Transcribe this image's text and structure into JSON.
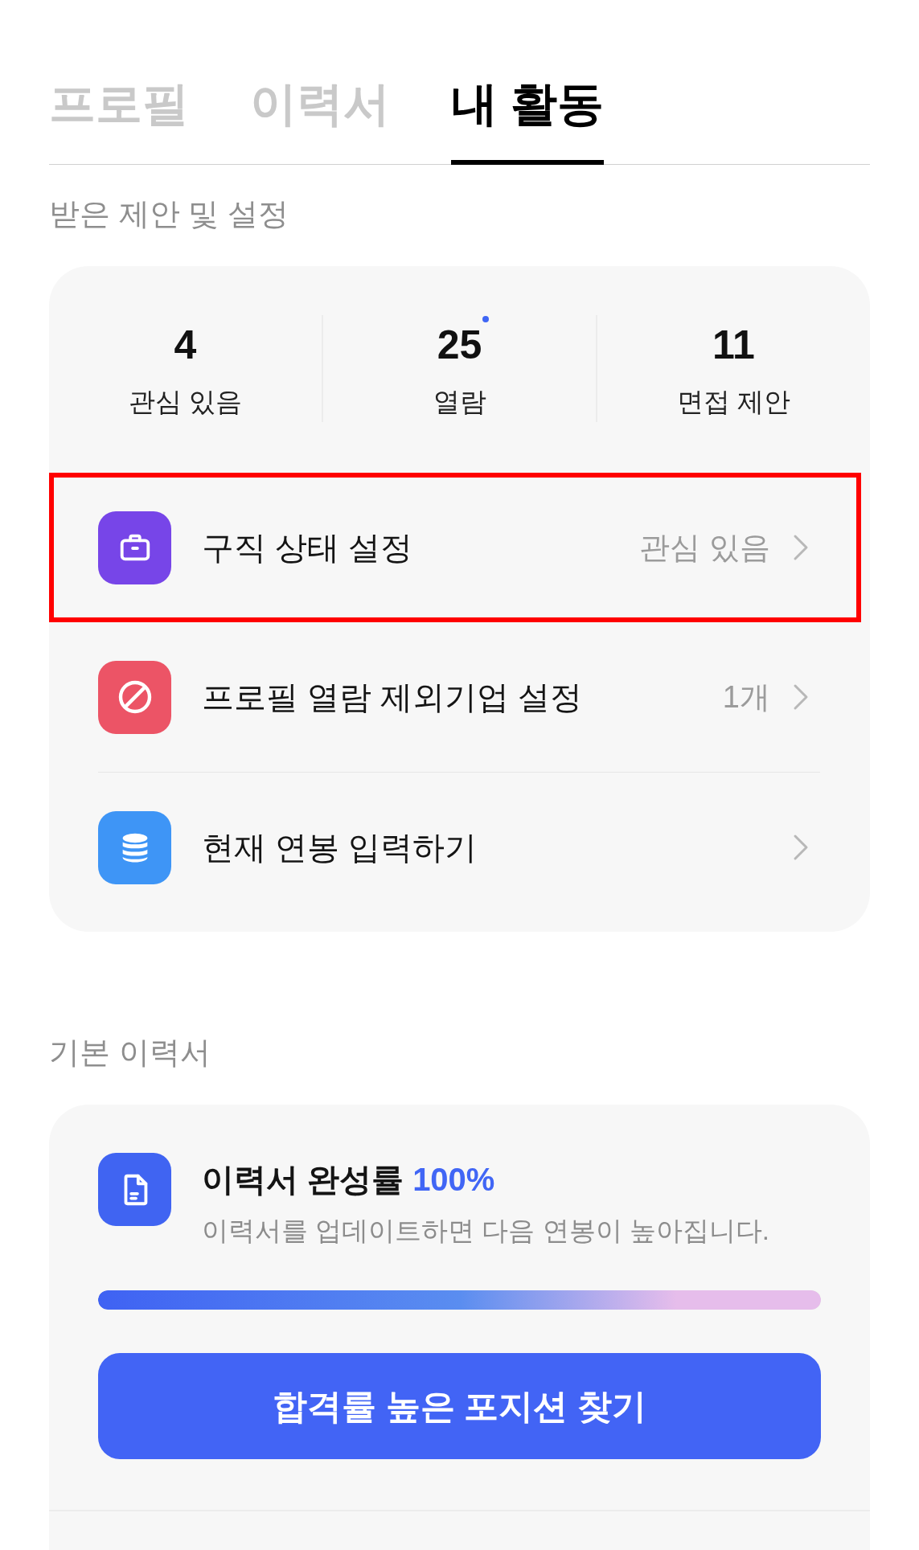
{
  "tabs": [
    {
      "label": "프로필",
      "selected": false
    },
    {
      "label": "이력서",
      "selected": false
    },
    {
      "label": "내 활동",
      "selected": true
    }
  ],
  "offers_settings": {
    "heading": "받은 제안 및 설정",
    "stats": [
      {
        "value": "4",
        "label": "관심 있음",
        "new": false
      },
      {
        "value": "25",
        "label": "열람",
        "new": true
      },
      {
        "value": "11",
        "label": "면접 제안",
        "new": false
      }
    ],
    "rows": [
      {
        "label": "구직 상태 설정",
        "value": "관심 있음",
        "color": "#7745e8",
        "highlighted": true
      },
      {
        "label": "프로필 열람 제외기업 설정",
        "value": "1개",
        "color": "#ec5466",
        "highlighted": false
      },
      {
        "label": "현재 연봉 입력하기",
        "color": "#3e95f6",
        "highlighted": false
      }
    ]
  },
  "resume": {
    "heading": "기본 이력서",
    "color": "#4064f2",
    "title": "이력서 완성률",
    "percent": "100%",
    "subtitle": "이력서를 업데이트하면 다음 연봉이 높아집니다.",
    "progress": {
      "level": 1
    },
    "button": "합격률 높은 포지션 찾기"
  }
}
